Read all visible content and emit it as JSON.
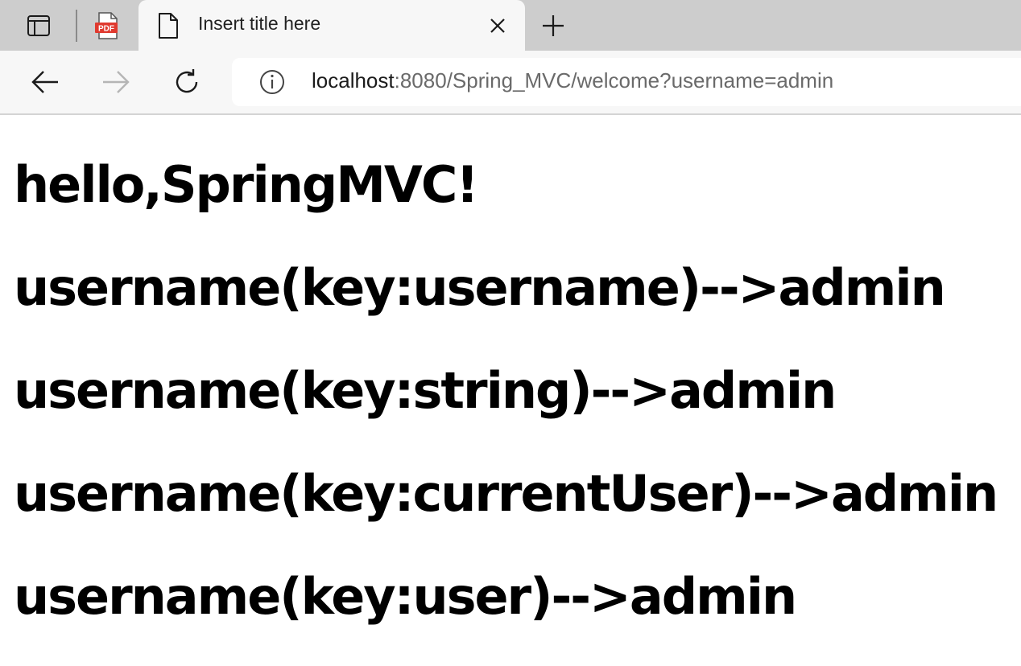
{
  "browser": {
    "tabs": [
      {
        "label": "Insert title here",
        "active": true
      }
    ],
    "pdf_tab_badge": "PDF",
    "address_bar": {
      "host": "localhost",
      "rest": ":8080/Spring_MVC/welcome?username=admin"
    }
  },
  "page": {
    "lines": [
      "hello,SpringMVC!",
      "username(key:username)-->admin",
      "username(key:string)-->admin",
      "username(key:currentUser)-->admin",
      "username(key:user)-->admin"
    ]
  },
  "colors": {
    "tabstrip_bg": "#cdcdcd",
    "toolbar_bg": "#f7f7f7",
    "pdf_red": "#e03a2f"
  }
}
